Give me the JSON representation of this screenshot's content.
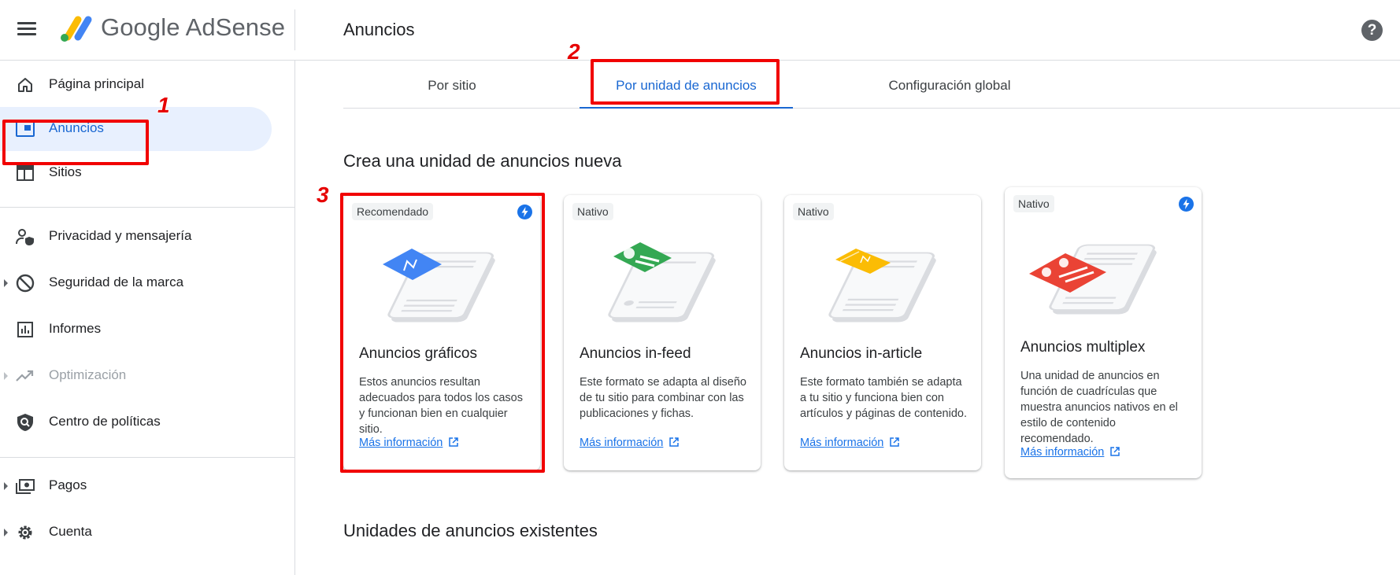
{
  "app": {
    "brand": "Google AdSense",
    "page_title": "Anuncios"
  },
  "sidebar": {
    "items": [
      {
        "label": "Página principal",
        "icon": "home-icon"
      },
      {
        "label": "Anuncios",
        "icon": "ads-icon",
        "active": true
      },
      {
        "label": "Sitios",
        "icon": "sites-icon"
      },
      {
        "label": "Privacidad y mensajería",
        "icon": "privacy-icon"
      },
      {
        "label": "Seguridad de la marca",
        "icon": "block-icon"
      },
      {
        "label": "Informes",
        "icon": "reports-icon"
      },
      {
        "label": "Optimización",
        "icon": "trending-icon",
        "disabled": true
      },
      {
        "label": "Centro de políticas",
        "icon": "policy-shield-icon"
      },
      {
        "label": "Pagos",
        "icon": "payments-icon"
      },
      {
        "label": "Cuenta",
        "icon": "gear-icon"
      }
    ]
  },
  "tabs": [
    {
      "label": "Por sitio"
    },
    {
      "label": "Por unidad de anuncios",
      "active": true
    },
    {
      "label": "Configuración global"
    }
  ],
  "sections": {
    "create_new": "Crea una unidad de anuncios nueva",
    "existing": "Unidades de anuncios existentes"
  },
  "cards": [
    {
      "chip": "Recomendado",
      "title": "Anuncios gráficos",
      "description": "Estos anuncios resultan adecuados para todos los casos y funcionan bien en cualquier sitio.",
      "link": "Más información",
      "accent": "#4285f4",
      "bolt": true
    },
    {
      "chip": "Nativo",
      "title": "Anuncios in-feed",
      "description": "Este formato se adapta al diseño de tu sitio para combinar con las publicaciones y fichas.",
      "link": "Más información",
      "accent": "#34a853",
      "bolt": false
    },
    {
      "chip": "Nativo",
      "title": "Anuncios in-article",
      "description": "Este formato también se adapta a tu sitio y funciona bien con artículos y páginas de contenido.",
      "link": "Más información",
      "accent": "#fbbc04",
      "bolt": false
    },
    {
      "chip": "Nativo",
      "title": "Anuncios multiplex",
      "description": "Una unidad de anuncios en función de cuadrículas que muestra anuncios nativos en el estilo de contenido recomendado.",
      "link": "Más información",
      "accent": "#ea4335",
      "bolt": true
    }
  ],
  "annotations": {
    "n1": "1",
    "n2": "2",
    "n3": "3",
    "color": "#f10000"
  },
  "colors": {
    "primary": "#1967d2",
    "active_bg": "#e8f0fe"
  }
}
